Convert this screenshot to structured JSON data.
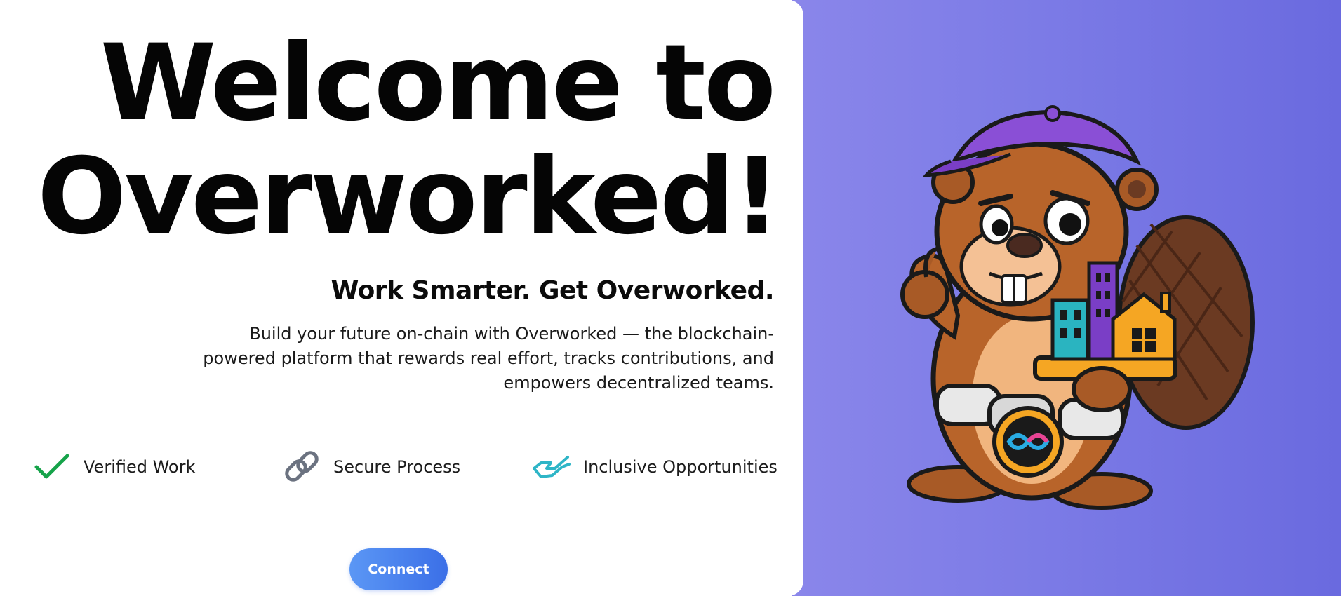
{
  "hero": {
    "title_line1": "Welcome to",
    "title_line2": "Overworked!",
    "subtitle": "Work Smarter. Get Overworked.",
    "description": "Build your future on-chain with Overworked — the blockchain-powered platform that rewards real effort, tracks contributions, and empowers decentralized teams."
  },
  "features": [
    {
      "label": "Verified Work",
      "icon": "check-icon",
      "color": "#16a34a"
    },
    {
      "label": "Secure Process",
      "icon": "link-icon",
      "color": "#6b7280"
    },
    {
      "label": "Inclusive Opportunities",
      "icon": "handshake-icon",
      "color": "#2eb5c7"
    }
  ],
  "connect_button": {
    "label": "Connect"
  },
  "colors": {
    "panel_gradient_start": "#8a86ea",
    "panel_gradient_end": "#6a6adf",
    "button_gradient_start": "#5b97f5",
    "button_gradient_end": "#3b6fe7",
    "title": "#050505"
  },
  "mascot": {
    "icon": "beaver-mascot-illustration"
  }
}
